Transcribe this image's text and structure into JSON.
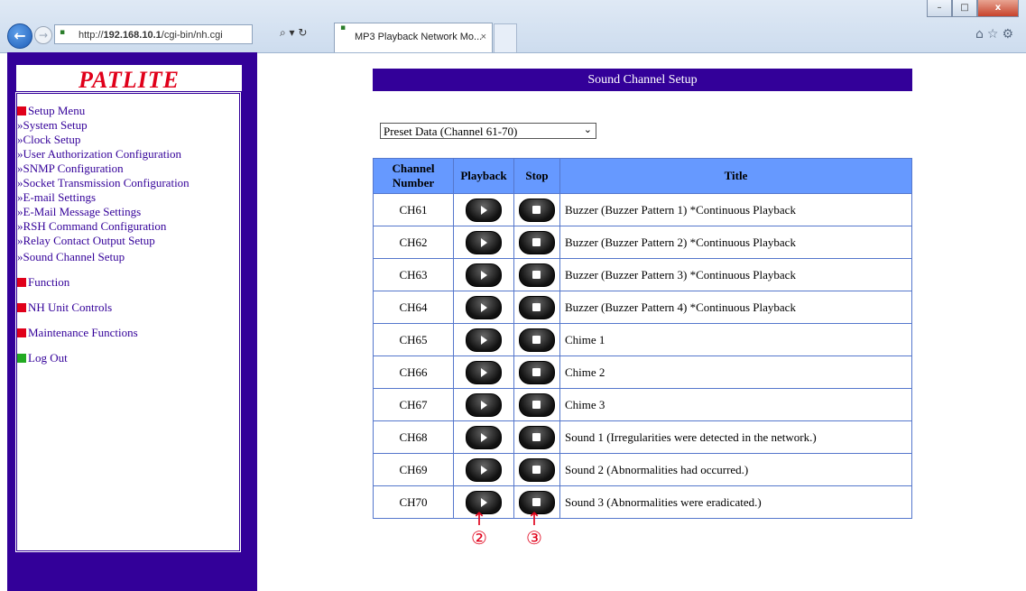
{
  "browser": {
    "url_prefix": "http://",
    "url_host": "192.168.10.1",
    "url_path": "/cgi-bin/nh.cgi",
    "tab_title": "MP3 Playback Network Mo...",
    "tab_close": "×",
    "search_control": "⌕ ▾ ↻",
    "win_minimize": "–",
    "win_maximize": "□",
    "win_close": "x",
    "tools": "⌂☆⚙"
  },
  "sidebar": {
    "logo": "PATLITE",
    "setup_menu": "Setup Menu",
    "links": [
      "»System Setup",
      "»Clock Setup",
      "»User Authorization Configuration",
      "»SNMP Configuration",
      "»Socket Transmission Configuration",
      "»E-mail Settings",
      "»E-Mail Message Settings",
      "»RSH Command Configuration",
      "»Relay Contact Output Setup",
      "»Sound Channel Setup"
    ],
    "function": "Function",
    "nh_unit_controls": "NH Unit Controls",
    "maintenance": "Maintenance Functions",
    "logout": "Log Out"
  },
  "main": {
    "title": "Sound Channel Setup",
    "preset_selected": "Preset Data (Channel 61-70)",
    "columns": [
      "Channel Number",
      "Playback",
      "Stop",
      "Title"
    ],
    "rows": [
      {
        "ch": "CH61",
        "title": "Buzzer (Buzzer Pattern 1) *Continuous Playback"
      },
      {
        "ch": "CH62",
        "title": "Buzzer (Buzzer Pattern 2) *Continuous Playback"
      },
      {
        "ch": "CH63",
        "title": "Buzzer (Buzzer Pattern 3) *Continuous Playback"
      },
      {
        "ch": "CH64",
        "title": "Buzzer (Buzzer Pattern 4) *Continuous Playback"
      },
      {
        "ch": "CH65",
        "title": "Chime 1"
      },
      {
        "ch": "CH66",
        "title": "Chime 2"
      },
      {
        "ch": "CH67",
        "title": "Chime 3"
      },
      {
        "ch": "CH68",
        "title": "Sound 1 (Irregularities were detected in the network.)"
      },
      {
        "ch": "CH69",
        "title": "Sound 2 (Abnormalities had occurred.)"
      },
      {
        "ch": "CH70",
        "title": "Sound 3 (Abnormalities were eradicated.)"
      }
    ],
    "annotations": [
      {
        "arrow": "↑",
        "label": "②"
      },
      {
        "arrow": "↑",
        "label": "③"
      }
    ]
  },
  "colors": {
    "frame": "#330099",
    "header": "#6699ff",
    "logo": "#e0001a",
    "annotation": "#e0001a"
  }
}
